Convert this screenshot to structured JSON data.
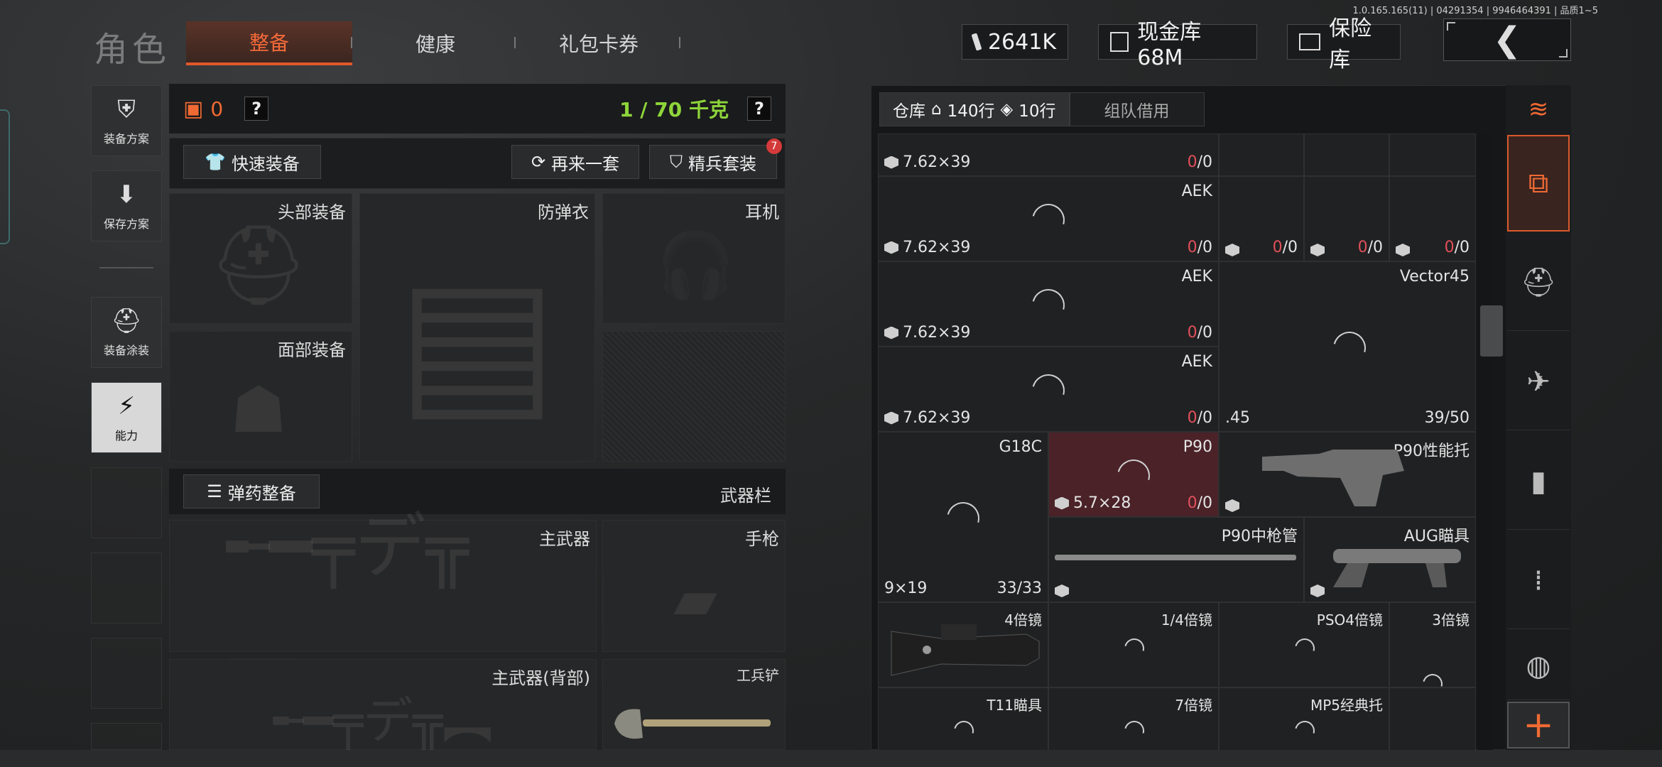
{
  "version_info": "1.0.165.165(11) | 04291354 | 9946464391 | 品质1~5",
  "header": {
    "title": "角色",
    "tabs": [
      {
        "label": "整备",
        "active": true
      },
      {
        "label": "健康",
        "active": false
      },
      {
        "label": "礼包卡券",
        "active": false
      }
    ],
    "currency": {
      "cash": "2641K",
      "cash_vault": "现金库 68M",
      "insurance_vault": "保险库"
    },
    "back_icon": "chevron-left-icon"
  },
  "left_nav": [
    {
      "label": "装备方案",
      "icon": "armor-plan-icon"
    },
    {
      "label": "保存方案",
      "icon": "download-icon"
    },
    {
      "label": "装备涂装",
      "icon": "helmet-paint-icon"
    },
    {
      "label": "能力",
      "icon": "lightning-hex-icon",
      "selected": true
    }
  ],
  "equipment": {
    "armor_count": "0",
    "help": "?",
    "weight": "1 / 70 千克",
    "quick_equip": "快速装备",
    "again": "再来一套",
    "elite_set": "精兵套装",
    "elite_badge": "7",
    "slots": {
      "head": "头部装备",
      "armor": "防弹衣",
      "headset": "耳机",
      "face": "面部装备",
      "primary": "主武器",
      "pistol": "手枪",
      "primary_back": "主武器(背部)",
      "shovel": "工兵铲"
    },
    "ammo_prep": "弹药整备",
    "weapon_bar": "武器栏"
  },
  "warehouse": {
    "tab_label": "仓库",
    "home_rows": "140行",
    "tag_rows": "10行",
    "team_borrow": "组队借用",
    "cells": [
      {
        "name": "",
        "cal": "7.62×39",
        "cnt_a": "0",
        "cnt_b": "/0"
      },
      {
        "name": "AEK",
        "cal": "7.62×39",
        "cnt_a": "0",
        "cnt_b": "/0"
      },
      {
        "name": "AEK",
        "cal": "7.62×39",
        "cnt_a": "0",
        "cnt_b": "/0"
      },
      {
        "name": "AEK",
        "cal": "7.62×39",
        "cnt_a": "0",
        "cnt_b": "/0"
      },
      {
        "name": "G18C",
        "cal": "9×19",
        "cnt_a": "",
        "cnt_b": "33/33"
      },
      {
        "name": "P90",
        "cal": "5.7×28",
        "cnt_a": "0",
        "cnt_b": "/0"
      },
      {
        "name": "P90性能托",
        "cal": "",
        "cnt_a": "",
        "cnt_b": ""
      },
      {
        "name": "Vector45",
        "cal": ".45",
        "cnt_a": "",
        "cnt_b": "39/50"
      },
      {
        "name": "P90中枪管",
        "cal": "",
        "cnt_a": "",
        "cnt_b": ""
      },
      {
        "name": "AUG瞄具",
        "cal": "",
        "cnt_a": "",
        "cnt_b": ""
      },
      {
        "name": "4倍镜"
      },
      {
        "name": "1/4倍镜"
      },
      {
        "name": "PSO4倍镜"
      },
      {
        "name": "3倍镜"
      },
      {
        "name": "T11瞄具"
      },
      {
        "name": "7倍镜"
      },
      {
        "name": "MP5经典托"
      },
      {
        "name": "",
        "cal": "",
        "cnt_a": "0",
        "cnt_b": "/0"
      },
      {
        "name": "",
        "cal": "",
        "cnt_a": "0",
        "cnt_b": "/0"
      },
      {
        "name": "",
        "cal": "",
        "cnt_a": "0",
        "cnt_b": "/0"
      }
    ]
  },
  "categories": [
    "layers-refresh-icon",
    "stack-download-icon",
    "helmet-icon",
    "rifle-icon",
    "magazine-icon",
    "bullets-icon",
    "scope-icon"
  ],
  "plus": "+",
  "colors": {
    "accent": "#f06a33",
    "weight": "#8ed53a",
    "count_red": "#e0505a"
  }
}
